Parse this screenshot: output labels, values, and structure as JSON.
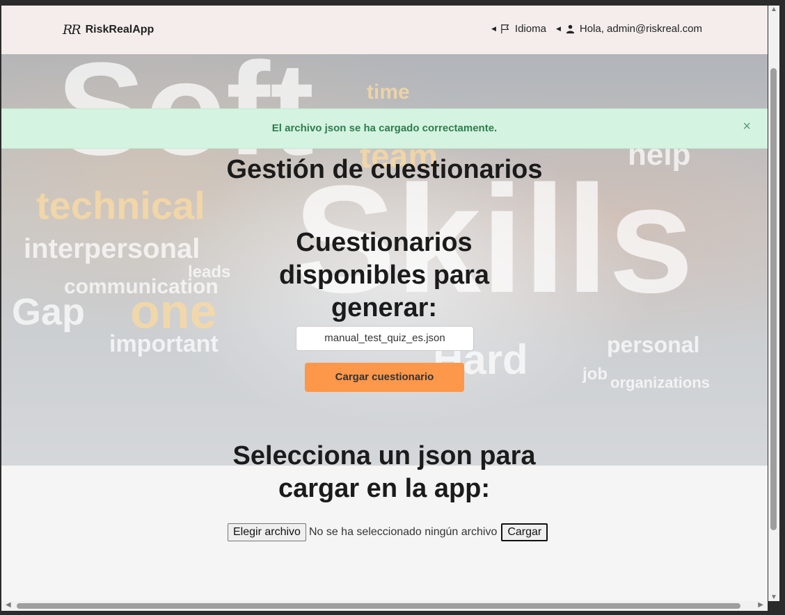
{
  "navbar": {
    "brand_logo": "RR",
    "brand_name": "RiskRealApp",
    "language_label": "Idioma",
    "user_greeting": "Hola, admin@riskreal.com"
  },
  "alert": {
    "message": "El archivo json se ha cargado correctamente.",
    "close_symbol": "×"
  },
  "page": {
    "title": "Gestión de cuestionarios",
    "available_heading": "Cuestionarios disponibles para generar:",
    "selected_quiz": "manual_test_quiz_es.json",
    "load_quiz_button": "Cargar cuestionario",
    "select_heading": "Selecciona un json para cargar en la app:",
    "choose_file_button": "Elegir archivo",
    "no_file_text": "No se ha seleccionado ningún archivo",
    "upload_button": "Cargar"
  },
  "hero_background_words": [
    "Soft",
    "Skills",
    "technical",
    "interpersonal",
    "communication",
    "Gap",
    "one",
    "important",
    "team",
    "help",
    "personal",
    "organizations",
    "Hard",
    "time",
    "leads",
    "job"
  ],
  "colors": {
    "navbar_bg": "#f3ecea",
    "alert_bg": "#d4f3e0",
    "alert_text": "#2e7d4f",
    "accent_button": "#fd974a",
    "page_bg": "#f5f5f5"
  },
  "icons": {
    "language": "flag-icon",
    "user": "user-icon",
    "caret": "caret-left-icon",
    "close": "close-icon"
  }
}
